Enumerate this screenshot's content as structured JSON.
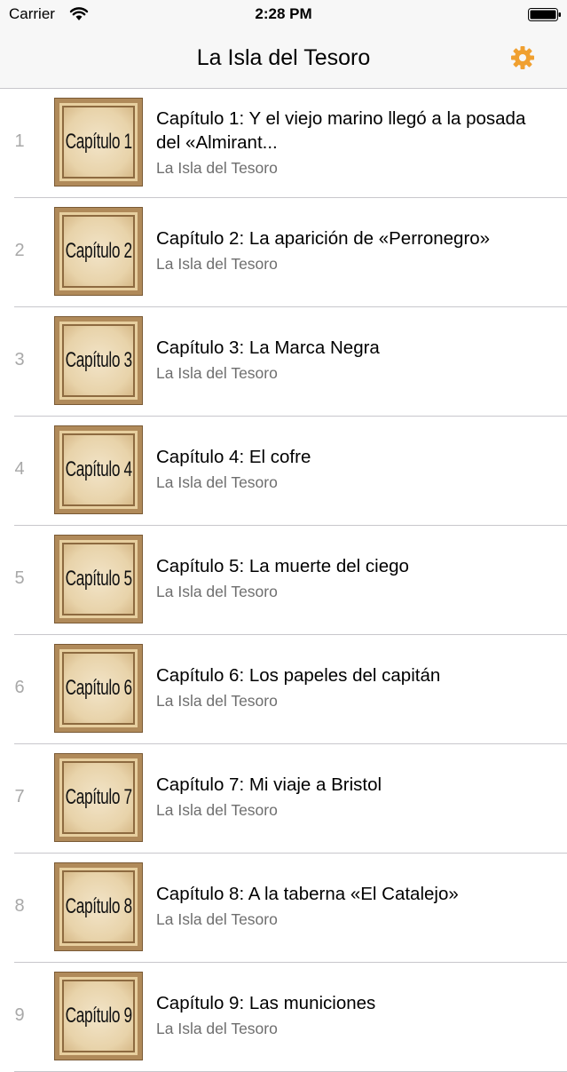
{
  "status_bar": {
    "carrier": "Carrier",
    "time": "2:28 PM"
  },
  "nav": {
    "title": "La Isla del Tesoro",
    "settings_icon": "gear-icon",
    "accent_color": "#f0a030"
  },
  "chapters": [
    {
      "index": "1",
      "thumb": "Capítulo 1",
      "title": "Capítulo 1: Y el viejo marino llegó a la posada del «Almirant...",
      "subtitle": "La Isla del Tesoro"
    },
    {
      "index": "2",
      "thumb": "Capítulo 2",
      "title": "Capítulo 2: La aparición de «Perronegro»",
      "subtitle": "La Isla del Tesoro"
    },
    {
      "index": "3",
      "thumb": "Capítulo 3",
      "title": "Capítulo 3: La Marca Negra",
      "subtitle": "La Isla del Tesoro"
    },
    {
      "index": "4",
      "thumb": "Capítulo 4",
      "title": "Capítulo 4: El cofre",
      "subtitle": "La Isla del Tesoro"
    },
    {
      "index": "5",
      "thumb": "Capítulo 5",
      "title": "Capítulo 5: La muerte del ciego",
      "subtitle": "La Isla del Tesoro"
    },
    {
      "index": "6",
      "thumb": "Capítulo 6",
      "title": "Capítulo 6: Los papeles del capitán",
      "subtitle": "La Isla del Tesoro"
    },
    {
      "index": "7",
      "thumb": "Capítulo 7",
      "title": "Capítulo 7: Mi viaje a Bristol",
      "subtitle": "La Isla del Tesoro"
    },
    {
      "index": "8",
      "thumb": "Capítulo 8",
      "title": "Capítulo 8: A la taberna «El Catalejo»",
      "subtitle": "La Isla del Tesoro"
    },
    {
      "index": "9",
      "thumb": "Capítulo 9",
      "title": "Capítulo 9: Las municiones",
      "subtitle": "La Isla del Tesoro"
    }
  ]
}
